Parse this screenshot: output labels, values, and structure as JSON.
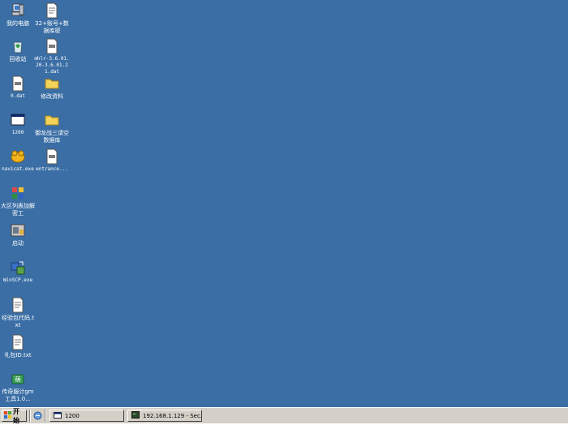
{
  "desktop": {
    "background_color": "#3a6ea5",
    "icons": [
      {
        "name": "my-computer",
        "label": "我的电脑",
        "icon": "computer-icon"
      },
      {
        "name": "recycle-bin",
        "label": "回收站",
        "icon": "recycle-bin-icon"
      },
      {
        "name": "0-dat",
        "label": "0.dat",
        "icon": "file-icon"
      },
      {
        "name": "1200",
        "label": "1200",
        "icon": "window-icon"
      },
      {
        "name": "navicat",
        "label": "navicat.exe",
        "icon": "navicat-icon"
      },
      {
        "name": "dagu-unlock-tool",
        "label": "大区列表加解密工",
        "icon": "tool-icon"
      },
      {
        "name": "launch",
        "label": "启动",
        "icon": "launcher-icon"
      },
      {
        "name": "winscp",
        "label": "WinSCP.exe",
        "icon": "winscp-icon"
      },
      {
        "name": "gift-code-txt",
        "label": "经验包代码.txt",
        "icon": "text-file-icon"
      },
      {
        "name": "gift-id-txt",
        "label": "礼包ID.txt",
        "icon": "text-file-icon"
      },
      {
        "name": "gm-tool",
        "label": "传奇服计gm工具1.0...",
        "icon": "gm-tool-icon"
      },
      {
        "name": "account-data",
        "label": "32+账号+数据库密",
        "icon": "text-file-icon"
      },
      {
        "name": "mhlr-dat",
        "label": "mhlr-3.6.01.20-3.6.01.21.dat",
        "icon": "dat-file-icon"
      },
      {
        "name": "modify-data-folder",
        "label": "修改资料",
        "icon": "folder-icon"
      },
      {
        "name": "clear-db-folder",
        "label": "御龙战三请空数据库",
        "icon": "folder-icon"
      },
      {
        "name": "entrance",
        "label": "entrance...",
        "icon": "dat-file-icon"
      }
    ]
  },
  "taskbar": {
    "start_label": "开始",
    "tasks": [
      {
        "label": "1200",
        "icon": "window-icon"
      },
      {
        "label": "192.168.1.129 - Sec...",
        "icon": "terminal-icon"
      }
    ]
  }
}
